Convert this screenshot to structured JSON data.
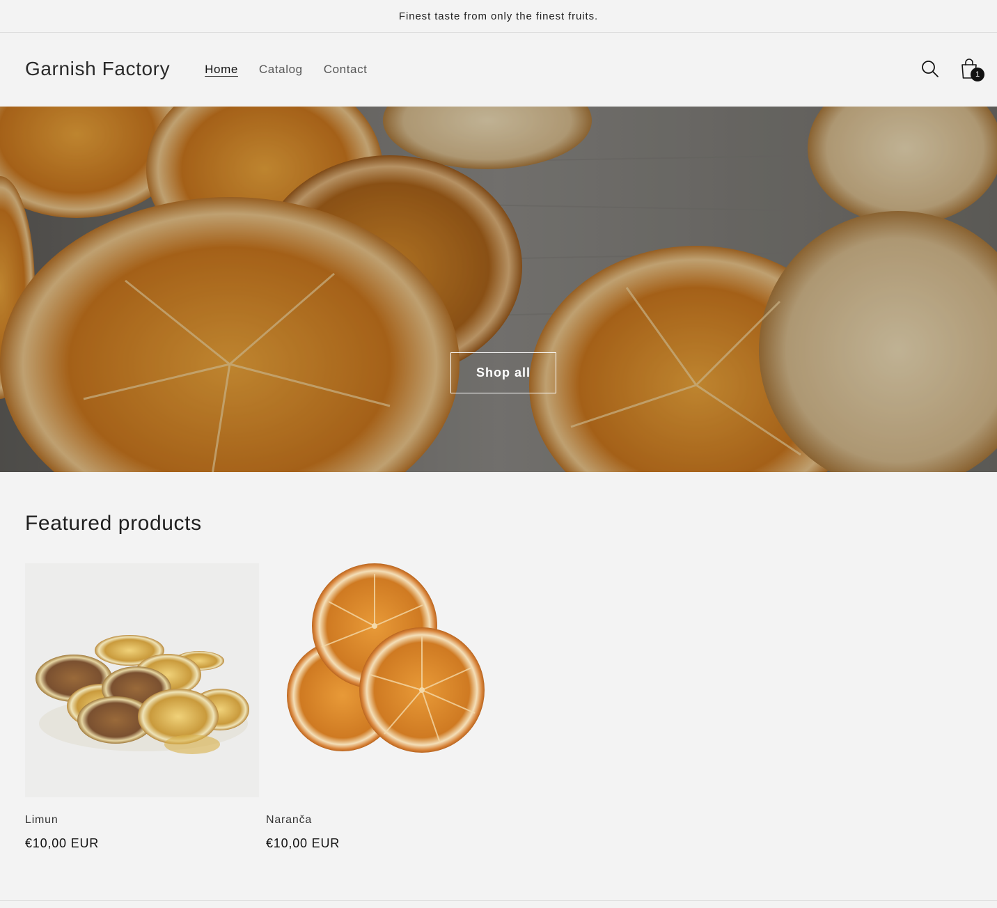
{
  "announcement": {
    "text": "Finest taste from only the finest fruits."
  },
  "header": {
    "logo": "Garnish Factory",
    "nav": [
      {
        "label": "Home",
        "active": true
      },
      {
        "label": "Catalog",
        "active": false
      },
      {
        "label": "Contact",
        "active": false
      }
    ],
    "search_icon": "search-icon",
    "cart_icon": "cart-icon",
    "cart_count": "1"
  },
  "hero": {
    "button_label": "Shop all",
    "image": "dried orange and apple slices on wooden table"
  },
  "featured": {
    "heading": "Featured products",
    "products": [
      {
        "title": "Limun",
        "price": "€10,00 EUR",
        "image": "dried lemon slices"
      },
      {
        "title": "Naranča",
        "price": "€10,00 EUR",
        "image": "dried orange slices"
      }
    ]
  },
  "colors": {
    "background": "#f3f3f3",
    "text": "#121212",
    "badge": "#121212"
  }
}
